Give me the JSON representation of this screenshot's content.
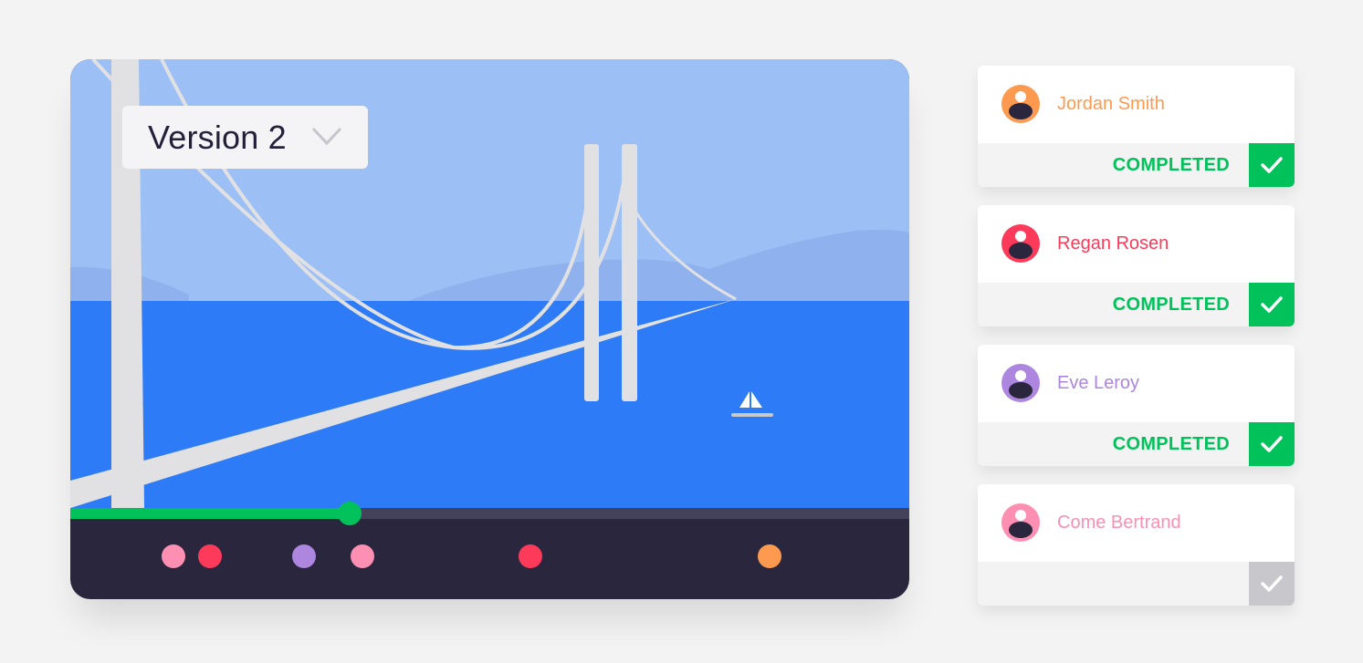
{
  "colors": {
    "background": "#f3f3f3",
    "sky": "#9cbff5",
    "mountains": "#8fb2ee",
    "water": "#2d7bf6",
    "bridge": "#e1e1e3",
    "player_bar": "#29263d",
    "track": "#43425a",
    "progress": "#00c15a",
    "completed": "#00c15a",
    "pending": "#c8c8cc",
    "avatar_head": "#ffffff",
    "avatar_body": "#29263d"
  },
  "player": {
    "version_label": "Version 2",
    "version_icon": "chevron-down-icon",
    "progress": 0.333,
    "markers": [
      {
        "person": "Come Bertrand",
        "color": "#fd8fb3",
        "position": 0.123
      },
      {
        "person": "Regan Rosen",
        "color": "#fd3a5a",
        "position": 0.167
      },
      {
        "person": "Eve Leroy",
        "color": "#ad86e0",
        "position": 0.279
      },
      {
        "person": "Come Bertrand",
        "color": "#fd8fb3",
        "position": 0.348
      },
      {
        "person": "Regan Rosen",
        "color": "#fd3a5a",
        "position": 0.548
      },
      {
        "person": "Jordan Smith",
        "color": "#fd9a4f",
        "position": 0.834
      }
    ]
  },
  "reviewers": [
    {
      "name": "Jordan Smith",
      "color": "#fd9a4f",
      "status": "COMPLETED",
      "completed": true,
      "icon": "check-icon"
    },
    {
      "name": "Regan Rosen",
      "color": "#fd3a5a",
      "status": "COMPLETED",
      "completed": true,
      "icon": "check-icon"
    },
    {
      "name": "Eve Leroy",
      "color": "#ad86e0",
      "status": "COMPLETED",
      "completed": true,
      "icon": "check-icon"
    },
    {
      "name": "Come Bertrand",
      "color": "#fd8fb3",
      "status": "",
      "completed": false,
      "icon": "check-icon"
    }
  ]
}
